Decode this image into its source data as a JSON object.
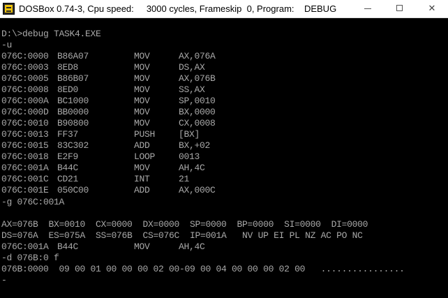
{
  "window": {
    "title": "DOSBox 0.74-3, Cpu speed:     3000 cycles, Frameskip  0, Program:    DEBUG",
    "minimize_label": "minimize",
    "maximize_label": "maximize",
    "close_label": "✕"
  },
  "console": {
    "command": "D:\\>debug TASK4.EXE",
    "prompt_u": "-u",
    "disassembly": [
      {
        "addr": "076C:0000",
        "bytes": "B86A07",
        "mnemonic": "MOV",
        "operands": "AX,076A"
      },
      {
        "addr": "076C:0003",
        "bytes": "8ED8",
        "mnemonic": "MOV",
        "operands": "DS,AX"
      },
      {
        "addr": "076C:0005",
        "bytes": "B86B07",
        "mnemonic": "MOV",
        "operands": "AX,076B"
      },
      {
        "addr": "076C:0008",
        "bytes": "8ED0",
        "mnemonic": "MOV",
        "operands": "SS,AX"
      },
      {
        "addr": "076C:000A",
        "bytes": "BC1000",
        "mnemonic": "MOV",
        "operands": "SP,0010"
      },
      {
        "addr": "076C:000D",
        "bytes": "BB0000",
        "mnemonic": "MOV",
        "operands": "BX,0000"
      },
      {
        "addr": "076C:0010",
        "bytes": "B90800",
        "mnemonic": "MOV",
        "operands": "CX,0008"
      },
      {
        "addr": "076C:0013",
        "bytes": "FF37",
        "mnemonic": "PUSH",
        "operands": "[BX]"
      },
      {
        "addr": "076C:0015",
        "bytes": "83C302",
        "mnemonic": "ADD",
        "operands": "BX,+02"
      },
      {
        "addr": "076C:0018",
        "bytes": "E2F9",
        "mnemonic": "LOOP",
        "operands": "0013"
      },
      {
        "addr": "076C:001A",
        "bytes": "B44C",
        "mnemonic": "MOV",
        "operands": "AH,4C"
      },
      {
        "addr": "076C:001C",
        "bytes": "CD21",
        "mnemonic": "INT",
        "operands": "21"
      },
      {
        "addr": "076C:001E",
        "bytes": "050C00",
        "mnemonic": "ADD",
        "operands": "AX,000C"
      }
    ],
    "prompt_g": "-g 076C:001A",
    "registers_line1": "AX=076B  BX=0010  CX=0000  DX=0000  SP=0000  BP=0000  SI=0000  DI=0000",
    "registers_line2": "DS=076A  ES=075A  SS=076B  CS=076C  IP=001A   NV UP EI PL NZ AC PO NC",
    "current_instr": {
      "addr": "076C:001A",
      "bytes": "B44C",
      "mnemonic": "MOV",
      "operands": "AH,4C"
    },
    "prompt_d": "-d 076B:0 f",
    "dump_line": "076B:0000  09 00 01 00 00 00 02 00-09 00 04 00 00 00 02 00   ................",
    "prompt_end": "-"
  }
}
